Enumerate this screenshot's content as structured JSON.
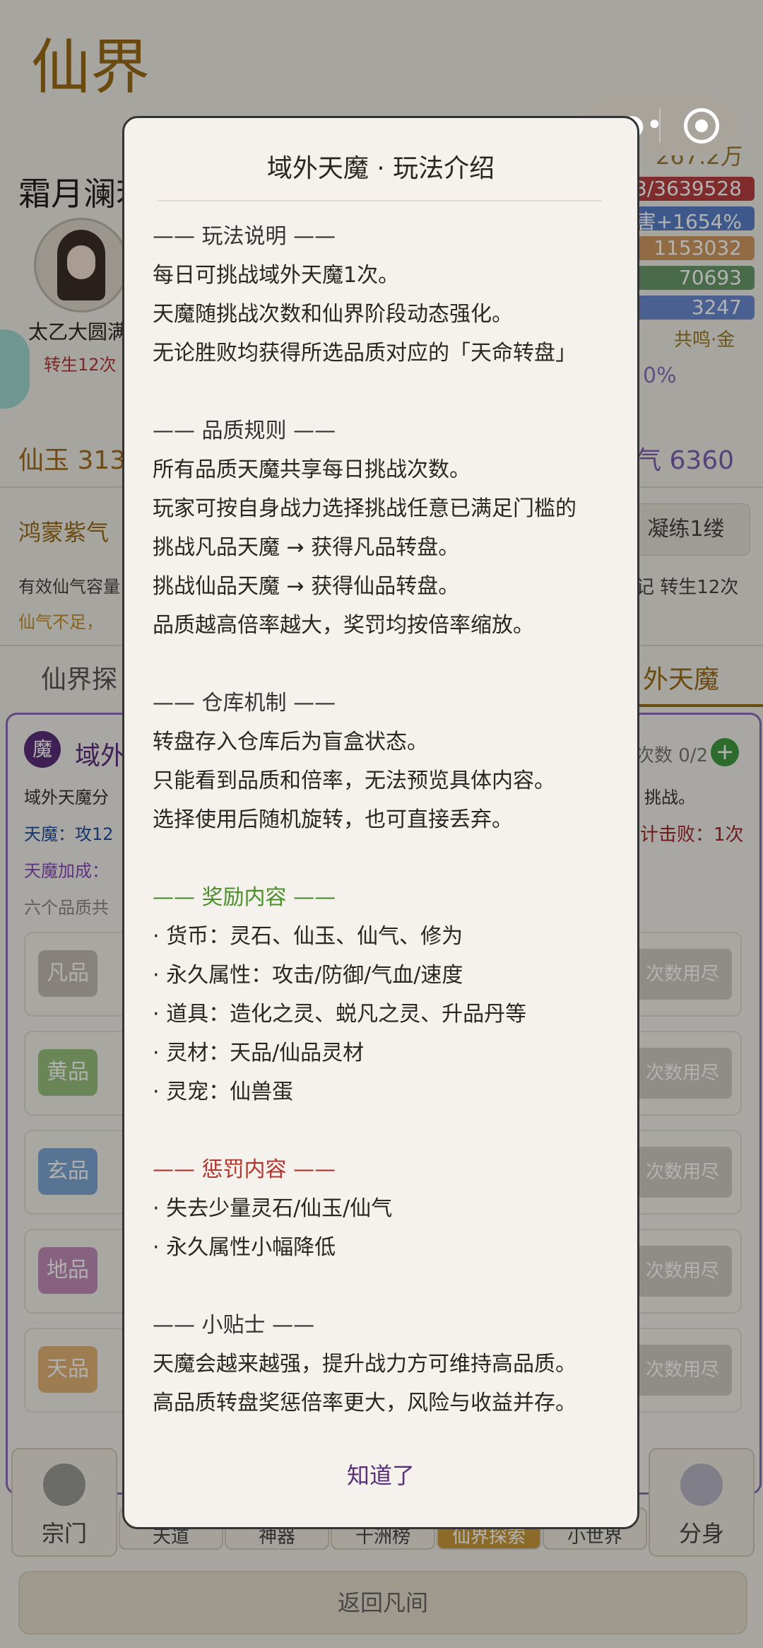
{
  "page": {
    "title": "仙界"
  },
  "player": {
    "name": "霜月澜若",
    "level": "太乙大圆满",
    "rebirth": "转生12次",
    "currency": "267.2万",
    "stats": [
      "3/3639528",
      "伤害+1654%",
      "1153032",
      "70693",
      "3247"
    ],
    "resonance": "共鸣·金",
    "percent": "0%"
  },
  "resources": {
    "xianyu": "仙玉 313",
    "xianqi": "气 6360"
  },
  "hongmeng": {
    "label": "鸿蒙紫气",
    "button": "凝练1缕",
    "effect_left": "有效仙气容量",
    "effect_right": "记 转生12次",
    "lack": "仙气不足，"
  },
  "tabs": {
    "left": "仙界探",
    "right": "外天魔"
  },
  "demon_panel": {
    "icon": "魔",
    "title": "域外",
    "attempts": "次数 0/2",
    "plus": "+",
    "desc": "域外天魔分",
    "desc_right": "挑战。",
    "demon_line": "天魔：攻12",
    "result": "计击败：1次",
    "bonus": "天魔加成：",
    "grades_intro": "六个品质共",
    "grades": [
      {
        "name": "凡品",
        "color": "#b8b3a8",
        "btn": "次数用尽"
      },
      {
        "name": "黄品",
        "color": "#8ab86a",
        "btn": "次数用尽"
      },
      {
        "name": "玄品",
        "color": "#6a9ad0",
        "btn": "次数用尽"
      },
      {
        "name": "地品",
        "color": "#b87ab0",
        "btn": "次数用尽"
      },
      {
        "name": "天品",
        "color": "#e0a860",
        "btn": "次数用尽"
      }
    ]
  },
  "bottom_nav": {
    "sect": "宗门",
    "clone": "分身",
    "mini": [
      "天道",
      "神器",
      "十洲榜",
      "仙界探索",
      "小世界"
    ],
    "back": "返回凡间"
  },
  "modal": {
    "title": "域外天魔 · 玩法介绍",
    "sections": [
      {
        "heading": "—— 玩法说明 ——",
        "tone": "normal",
        "lines": [
          "每日可挑战域外天魔1次。",
          "天魔随挑战次数和仙界阶段动态强化。",
          "无论胜败均获得所选品质对应的「天命转盘」"
        ]
      },
      {
        "heading": "—— 品质规则 ——",
        "tone": "normal",
        "lines": [
          "所有品质天魔共享每日挑战次数。",
          "玩家可按自身战力选择挑战任意已满足门槛的",
          "挑战凡品天魔 → 获得凡品转盘。",
          "挑战仙品天魔 → 获得仙品转盘。",
          "品质越高倍率越大，奖罚均按倍率缩放。"
        ]
      },
      {
        "heading": "—— 仓库机制 ——",
        "tone": "normal",
        "lines": [
          "转盘存入仓库后为盲盒状态。",
          "只能看到品质和倍率，无法预览具体内容。",
          "选择使用后随机旋转，也可直接丢弃。"
        ]
      },
      {
        "heading": "—— 奖励内容 ——",
        "tone": "green",
        "lines": [
          "· 货币：灵石、仙玉、仙气、修为",
          "· 永久属性：攻击/防御/气血/速度",
          "· 道具：造化之灵、蜕凡之灵、升品丹等",
          "· 灵材：天品/仙品灵材",
          "· 灵宠：仙兽蛋"
        ]
      },
      {
        "heading": "—— 惩罚内容 ——",
        "tone": "red",
        "lines": [
          "· 失去少量灵石/仙玉/仙气",
          "· 永久属性小幅降低"
        ]
      },
      {
        "heading": "—— 小贴士 ——",
        "tone": "normal",
        "lines": [
          "天魔会越来越强，提升战力方可维持高品质。",
          "高品质转盘奖惩倍率更大，风险与收益并存。"
        ]
      }
    ],
    "ok": "知道了"
  }
}
